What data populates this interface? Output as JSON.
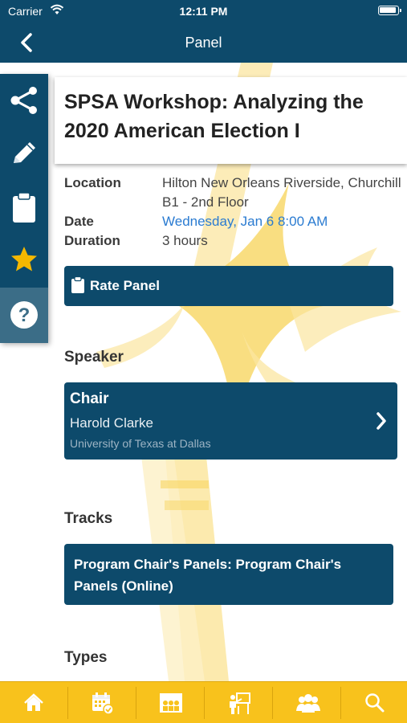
{
  "status_bar": {
    "carrier": "Carrier",
    "time": "12:11 PM"
  },
  "nav": {
    "title": "Panel",
    "back_icon": "chevron-left-icon"
  },
  "panel": {
    "title": "SPSA Workshop: Analyzing the 2020 American Election I",
    "details": [
      {
        "label": "Location",
        "value": "Hilton New Orleans Riverside, Churchill B1 - 2nd Floor",
        "is_link": false
      },
      {
        "label": "Date",
        "value": "Wednesday, Jan 6 8:00 AM",
        "is_link": true
      },
      {
        "label": "Duration",
        "value": "3 hours",
        "is_link": false
      }
    ],
    "rate_button": "Rate Panel"
  },
  "sections": {
    "speaker": "Speaker",
    "tracks": "Tracks",
    "types": "Types"
  },
  "speaker": {
    "role": "Chair",
    "name": "Harold Clarke",
    "org": "University of Texas at Dallas"
  },
  "track": {
    "label": "Program Chair's Panels: Program Chair's Panels (Online)"
  },
  "side_rail": [
    "share-icon",
    "pencil-icon",
    "clipboard-icon",
    "star-icon",
    "help-icon"
  ],
  "tab_bar": [
    "home-icon",
    "calendar-icon",
    "presentation-icon",
    "presenter-icon",
    "people-icon",
    "search-icon"
  ],
  "colors": {
    "primary": "#0d4a6b",
    "accent": "#f8c21c",
    "link": "#2a7bd1",
    "star": "#f5b800",
    "watermark": "#fbe7a1"
  }
}
